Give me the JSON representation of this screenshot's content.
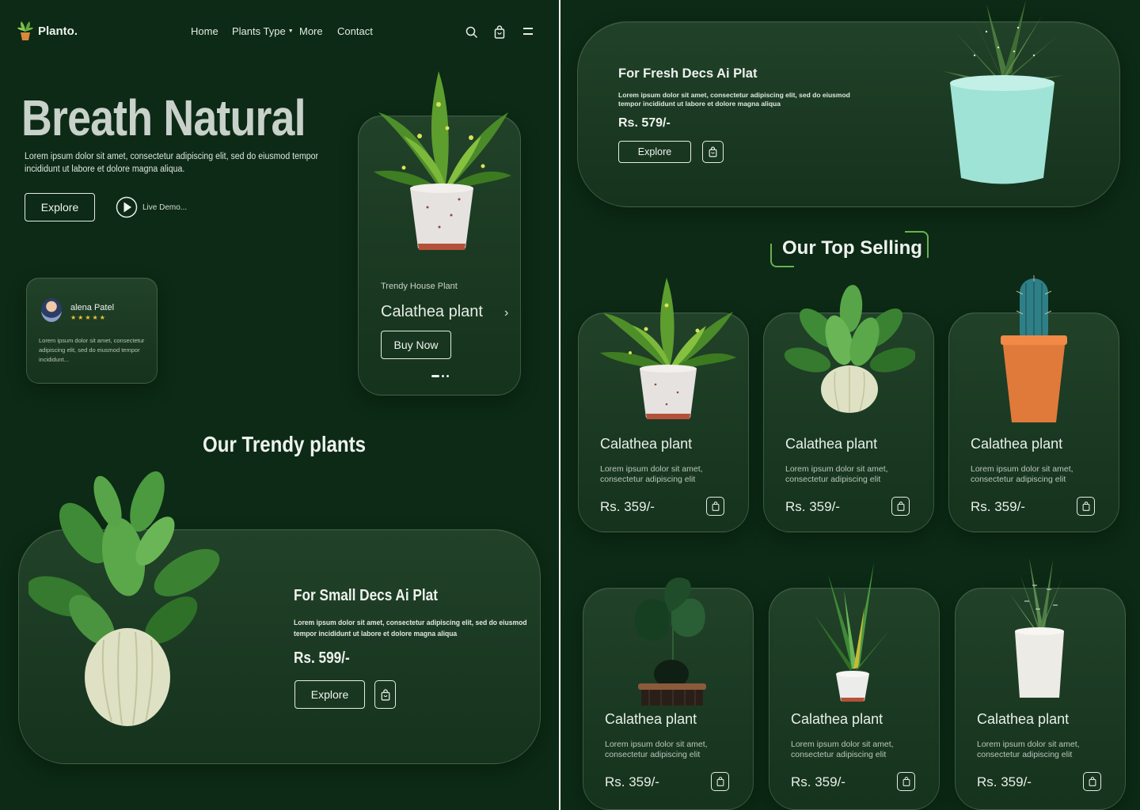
{
  "brand": {
    "name": "Planto."
  },
  "nav": {
    "home": "Home",
    "plants_type": "Plants Type",
    "more": "More",
    "contact": "Contact"
  },
  "hero": {
    "title": "Breath Natural",
    "desc_line1": "Lorem ipsum dolor sit amet, consectetur adipiscing elit, sed do eiusmod tempor",
    "desc_line2": "incididunt ut labore et dolore magna aliqua.",
    "explore": "Explore",
    "live_demo": "Live Demo..."
  },
  "review": {
    "name": "alena Patel",
    "stars": "★★★★★",
    "text_line1": "Lorem ipsum dolor sit amet, consectetur",
    "text_line2": "adipiscing elit, sed do eiusmod tempor",
    "text_line3": "incididunt..."
  },
  "featured": {
    "subtitle": "Trendy House Plant",
    "title": "Calathea plant",
    "button": "Buy Now"
  },
  "trendy": {
    "heading": "Our Trendy plants",
    "card_title": "For Small Decs Ai Plat",
    "desc_line1": "Lorem ipsum dolor sit amet, consectetur adipiscing elit, sed do eiusmod",
    "desc_line2": "tempor incididunt ut labore et dolore magna aliqua",
    "price": "Rs. 599/-",
    "explore": "Explore"
  },
  "fresh": {
    "title": "For Fresh Decs Ai Plat",
    "desc_line1": "Lorem ipsum dolor sit amet, consectetur adipiscing elit, sed do eiusmod",
    "desc_line2": "tempor incididunt ut labore et dolore magna aliqua",
    "price": "Rs. 579/-",
    "explore": "Explore"
  },
  "top_selling": {
    "heading": "Our Top Selling",
    "products": [
      {
        "name": "Calathea plant",
        "desc_line1": "Lorem ipsum dolor sit amet,",
        "desc_line2": "consectetur adipiscing elit",
        "price": "Rs. 359/-",
        "plant": "croton-white-pot"
      },
      {
        "name": "Calathea plant",
        "desc_line1": "Lorem ipsum dolor sit amet,",
        "desc_line2": "consectetur adipiscing elit",
        "price": "Rs. 359/-",
        "plant": "leafy-cream-vase"
      },
      {
        "name": "Calathea plant",
        "desc_line1": "Lorem ipsum dolor sit amet,",
        "desc_line2": "consectetur adipiscing elit",
        "price": "Rs. 359/-",
        "plant": "cactus-orange-pot"
      },
      {
        "name": "Calathea plant",
        "desc_line1": "Lorem ipsum dolor sit amet,",
        "desc_line2": "consectetur adipiscing elit",
        "price": "Rs. 359/-",
        "plant": "monstera-stand"
      },
      {
        "name": "Calathea plant",
        "desc_line1": "Lorem ipsum dolor sit amet,",
        "desc_line2": "consectetur adipiscing elit",
        "price": "Rs. 359/-",
        "plant": "spiky-white-pot"
      },
      {
        "name": "Calathea plant",
        "desc_line1": "Lorem ipsum dolor sit amet,",
        "desc_line2": "consectetur adipiscing elit",
        "price": "Rs. 359/-",
        "plant": "haworthia-white-pot"
      }
    ]
  },
  "colors": {
    "background": "#0c2a15",
    "card": "#1e3a24",
    "text": "#e8ede9",
    "accent_star": "#f2c230"
  }
}
